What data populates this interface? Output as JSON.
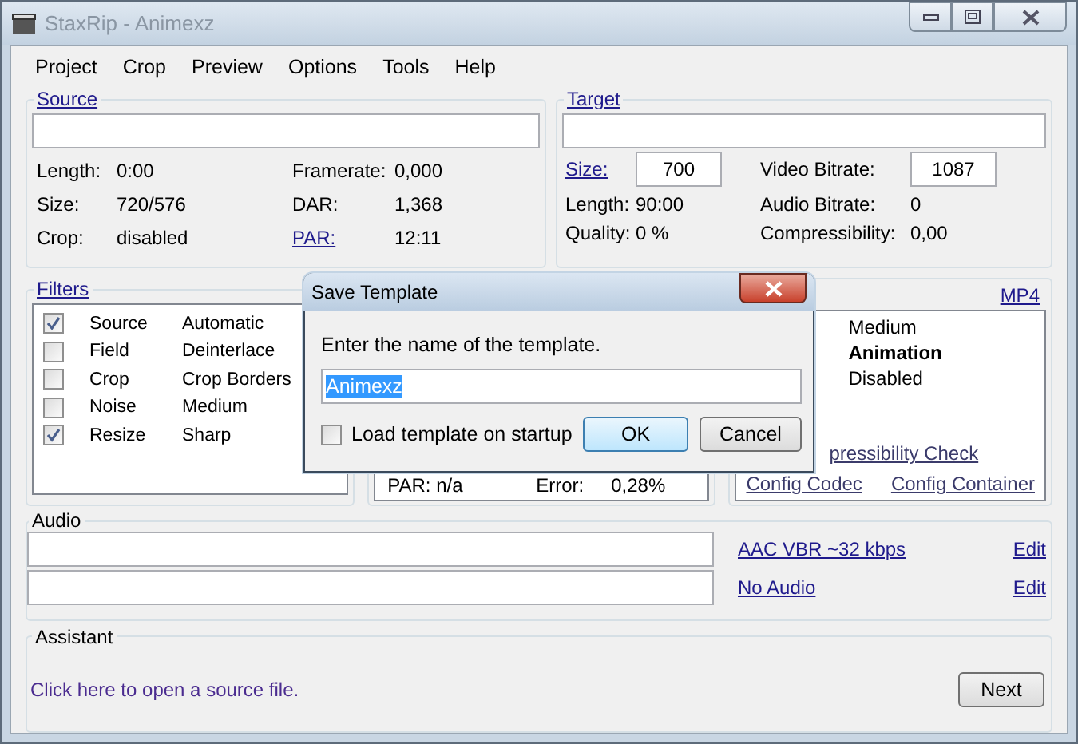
{
  "window": {
    "title": "StaxRip - Animexz"
  },
  "menu": [
    "Project",
    "Crop",
    "Preview",
    "Options",
    "Tools",
    "Help"
  ],
  "source": {
    "heading": "Source",
    "fields": [
      {
        "label": "Length:",
        "value": "0:00",
        "link": false
      },
      {
        "label": "Framerate:",
        "value": "0,000",
        "link": false
      },
      {
        "label": "Size:",
        "value": "720/576",
        "link": false
      },
      {
        "label": "DAR:",
        "value": "1,368",
        "link": false
      },
      {
        "label": "Crop:",
        "value": "disabled",
        "link": false
      },
      {
        "label": "PAR:",
        "value": "12:11",
        "link": true
      }
    ]
  },
  "target": {
    "heading": "Target",
    "fields": [
      {
        "label": "Size:",
        "value": "700",
        "link": true,
        "kind": "input"
      },
      {
        "label": "Video Bitrate:",
        "value": "1087",
        "link": false,
        "kind": "input"
      },
      {
        "label": "Length:",
        "value": "90:00",
        "link": false,
        "kind": "text"
      },
      {
        "label": "Audio Bitrate:",
        "value": "0",
        "link": false,
        "kind": "text"
      },
      {
        "label": "Quality:",
        "value": "0 %",
        "link": false,
        "kind": "text"
      },
      {
        "label": "Compressibility:",
        "value": "0,00",
        "link": false,
        "kind": "text"
      }
    ]
  },
  "filters": {
    "heading": "Filters",
    "items": [
      {
        "name": "Source",
        "value": "Automatic",
        "checked": true
      },
      {
        "name": "Field",
        "value": "Deinterlace",
        "checked": false
      },
      {
        "name": "Crop",
        "value": "Crop Borders",
        "checked": false
      },
      {
        "name": "Noise",
        "value": "Medium",
        "checked": false
      },
      {
        "name": "Resize",
        "value": "Sharp",
        "checked": true
      }
    ]
  },
  "resize_panel": {
    "par": "PAR: n/a",
    "error_label": "Error:",
    "error_value": "0,28%"
  },
  "encoder": {
    "container": "MP4",
    "values": [
      {
        "text": "Medium",
        "bold": false
      },
      {
        "text": "Animation",
        "bold": true
      },
      {
        "text": "Disabled",
        "bold": false
      }
    ],
    "check_link": "pressibility Check",
    "codec_link": "Config Codec",
    "container_link": "Config Container"
  },
  "audio": {
    "heading": "Audio",
    "tracks": [
      {
        "profile": "AAC VBR ~32 kbps",
        "edit": "Edit"
      },
      {
        "profile": "No Audio",
        "edit": "Edit"
      }
    ]
  },
  "assistant": {
    "heading": "Assistant",
    "message": "Click here to open a source file.",
    "button": "Next"
  },
  "dialog": {
    "title": "Save Template",
    "prompt": "Enter the name of the template.",
    "value": "Animexz",
    "value_selected": true,
    "checkbox": {
      "label": "Load template on startup",
      "checked": false
    },
    "buttons": [
      {
        "label": "OK",
        "default": true
      },
      {
        "label": "Cancel",
        "default": false
      }
    ]
  }
}
